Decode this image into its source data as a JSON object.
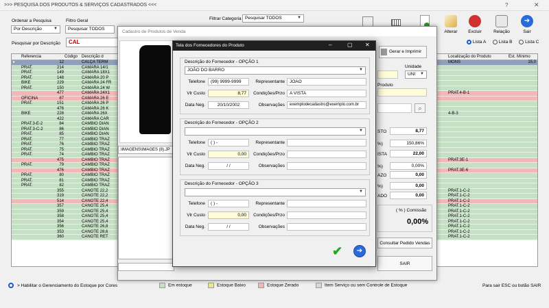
{
  "window": {
    "title": ">>> PESQUISA DOS PRODUTOS & SERVIÇOS CADASTRADOS <<<",
    "help": "?",
    "close": "✕"
  },
  "filters": {
    "ordenar_label": "Ordenar a Pesquisa",
    "ordenar_value": "Por Descrição",
    "filtro_label": "Filtro Geral",
    "filtro_value": "Pesquisar TODOS",
    "categoria_label": "Filtrar Categoria",
    "categoria_value": "Pesquisar TODOS",
    "pesquisar_label": "Pesquisar por Descrição",
    "pesquisar_value": "CAL"
  },
  "toolbar": {
    "alterar": "Alterar",
    "excluir": "Excluir",
    "relacao": "Relação",
    "sair": "Sair"
  },
  "lists": {
    "a": "Lista A",
    "b": "Lista B",
    "c": "Lista C"
  },
  "grid": {
    "headers": {
      "referencia": "Referencia",
      "codigo": "Código",
      "descricao": "Descrição d",
      "localizacao": "Localização do Produto",
      "est_minimo": "Est. Mínimo"
    },
    "rows": [
      {
        "ref": "",
        "cod": "12",
        "desc": "CALÇA TERM",
        "loc": "MONS",
        "min": "15,0",
        "c": "s"
      },
      {
        "ref": "PRAT.",
        "cod": "214",
        "desc": "CAMARA 14/1",
        "loc": "",
        "min": "",
        "c": "g"
      },
      {
        "ref": "PRAT.",
        "cod": "149",
        "desc": "CAMARA 18X1",
        "loc": "",
        "min": "",
        "c": "g"
      },
      {
        "ref": "PRAT.",
        "cod": "148",
        "desc": "CAMARA 20 P",
        "loc": "",
        "min": "",
        "c": "g"
      },
      {
        "ref": "BIKE",
        "cod": "229",
        "desc": "CAMARA 24 FR",
        "loc": "",
        "min": "",
        "c": "g"
      },
      {
        "ref": "PRAT.",
        "cod": "150",
        "desc": "CAMARA 24 W",
        "loc": "",
        "min": "",
        "c": "g"
      },
      {
        "ref": "",
        "cod": "477",
        "desc": "CAMARA 24X1",
        "loc": "PRAT.4-B-1",
        "min": "",
        "c": "p"
      },
      {
        "ref": "OFICINA",
        "cod": "87",
        "desc": "CAMARA 26 E",
        "loc": "",
        "min": "",
        "c": "p"
      },
      {
        "ref": "PRAT.",
        "cod": "151",
        "desc": "CAMARA 26 P",
        "loc": "",
        "min": "",
        "c": "g"
      },
      {
        "ref": "",
        "cod": "476",
        "desc": "CAMARA 26 K",
        "loc": "",
        "min": "",
        "c": "g"
      },
      {
        "ref": "BIKE",
        "cod": "228",
        "desc": "CAMARA 26X",
        "loc": "4-B-3",
        "min": "",
        "c": "g"
      },
      {
        "ref": "",
        "cod": "422",
        "desc": "CAMARA CAR",
        "loc": "",
        "min": "",
        "c": "g"
      },
      {
        "ref": "PRAT.3-E-2",
        "cod": "84",
        "desc": "CAMBIO DIAN",
        "loc": "",
        "min": "",
        "c": "g"
      },
      {
        "ref": "PRAT.3-C-2",
        "cod": "86",
        "desc": "CAMBIO DIAN",
        "loc": "",
        "min": "",
        "c": "g"
      },
      {
        "ref": "PRAT.",
        "cod": "85",
        "desc": "CAMBIO DIAN",
        "loc": "",
        "min": "",
        "c": "g"
      },
      {
        "ref": "PRAT.",
        "cod": "77",
        "desc": "CAMBIO TRAZ",
        "loc": "",
        "min": "",
        "c": "g"
      },
      {
        "ref": "PRAT.",
        "cod": "76",
        "desc": "CAMBIO TRAZ",
        "loc": "",
        "min": "",
        "c": "g"
      },
      {
        "ref": "PRAT.",
        "cod": "75",
        "desc": "CAMBIO TRAZ",
        "loc": "",
        "min": "",
        "c": "g"
      },
      {
        "ref": "PRAT.",
        "cod": "74",
        "desc": "CAMBIO TRAZ",
        "loc": "",
        "min": "",
        "c": "g"
      },
      {
        "ref": "",
        "cod": "475",
        "desc": "CAMBIO TRAZ",
        "loc": "PRAT.3E-1",
        "min": "",
        "c": "p"
      },
      {
        "ref": "PRAT.",
        "cod": "79",
        "desc": "CAMBIO TRAZ",
        "loc": "",
        "min": "",
        "c": "g"
      },
      {
        "ref": "",
        "cod": "476",
        "desc": "CAMBIO TRAZ",
        "loc": "PRAT.3E-6",
        "min": "",
        "c": "p"
      },
      {
        "ref": "PRAT.",
        "cod": "80",
        "desc": "CAMBIO TRAZ",
        "loc": "",
        "min": "",
        "c": "g"
      },
      {
        "ref": "PRAT.",
        "cod": "81",
        "desc": "CAMBIO TRAZ",
        "loc": "",
        "min": "",
        "c": "g"
      },
      {
        "ref": "PRAT.",
        "cod": "82",
        "desc": "CAMBIO TRAZ",
        "loc": "",
        "min": "",
        "c": "g"
      },
      {
        "ref": "",
        "cod": "355",
        "desc": "CANOTE 22,2",
        "loc": "PRAT.1-C-2",
        "min": "",
        "c": "g"
      },
      {
        "ref": "",
        "cod": "319",
        "desc": "CANOTE 22,2",
        "loc": "PRAT.1-C-2",
        "min": "",
        "c": "g"
      },
      {
        "ref": "",
        "cod": "514",
        "desc": "CANOTE 22,4",
        "loc": "PRAT.1-C-2",
        "min": "",
        "c": "p"
      },
      {
        "ref": "",
        "cod": "357",
        "desc": "CANOTE 25,4",
        "loc": "PRAT.1-C-2",
        "min": "",
        "c": "g"
      },
      {
        "ref": "",
        "cod": "359",
        "desc": "CANOTE 25,4",
        "loc": "PRAT.1-C-2",
        "min": "",
        "c": "g"
      },
      {
        "ref": "",
        "cod": "358",
        "desc": "CANOTE 25,4",
        "loc": "PRAT.1-C-2",
        "min": "",
        "c": "g"
      },
      {
        "ref": "",
        "cod": "354",
        "desc": "CANOTE 25,4",
        "loc": "PRAT.1-C-2",
        "min": "",
        "c": "g"
      },
      {
        "ref": "",
        "cod": "356",
        "desc": "CANOTE 26,8",
        "loc": "PRAT.1-C-2",
        "min": "",
        "c": "g"
      },
      {
        "ref": "",
        "cod": "353",
        "desc": "CANOTE 28,6",
        "loc": "PRAT.1-C-2",
        "min": "",
        "c": "g"
      },
      {
        "ref": "",
        "cod": "360",
        "desc": "CANOTE RET",
        "loc": "PRAT.1-C-2",
        "min": "",
        "c": "g"
      }
    ]
  },
  "bg_dialog": {
    "title": "Cadastro de Produtos de Venda",
    "image_path": ".\\IMAGENS\\IMAGES (8).JP",
    "gerar_imprimir": "Gerar e Imprimir",
    "unidade_label": "Unidade",
    "unidade_value": "UNI",
    "produto_label": "Produto",
    "custo_label": "STO",
    "custo_value": "8,77",
    "pct_label": "%)",
    "pct_value": "150,86%",
    "vista_label": "ISTA",
    "vista_value": "22,00",
    "pct2_label": "%)",
    "pct2_value": "0,00%",
    "prazo_label": "AZO",
    "prazo_value": "0,00",
    "row3_label": "%)",
    "row3_value": "0,00",
    "ado_label": "ADO",
    "ado_value": "0,00",
    "comissao_label": "( % ) Comissão",
    "comissao_value": "0,00%",
    "consultar": "Consultar Pedido Vendas",
    "sair": "SAIR"
  },
  "dialog": {
    "title": "Tela dos Fornecedores do Produto",
    "opcoes": [
      {
        "title": "Descrição do Fornecedor - OPÇÃO 1",
        "fornecedor": "JOÃO DO BARRO",
        "telefone": "(99) 9999-9999",
        "representante": "JOAO",
        "custo": "8,77",
        "condicoes": "A VISTA",
        "data": "20/10/2002",
        "observacoes": "exemplodecadastro@exemplo.com.br"
      },
      {
        "title": "Descrição do Fornecedor - OPÇÃO 2",
        "fornecedor": "",
        "telefone": "(  )    -",
        "representante": "",
        "custo": "0,00",
        "condicoes": "",
        "data": "/  /",
        "observacoes": ""
      },
      {
        "title": "Descrição do Fornecedor - OPÇÃO 3",
        "fornecedor": "",
        "telefone": "(  )    -",
        "representante": "",
        "custo": "0,00",
        "condicoes": "",
        "data": "/  /",
        "observacoes": ""
      }
    ],
    "labels": {
      "telefone": "Telefone",
      "representante": "Representante",
      "custo": "Vlr Custo",
      "condicoes": "Condições/Przo",
      "data": "Data Neg.",
      "observacoes": "Observações"
    }
  },
  "statusbar": {
    "habilitar": "> Habilitar o Gerenciamento do Estoque por Cores",
    "em_estoque": "Em estoque",
    "estoque_baixo": "Estoque Baixo",
    "estoque_zerado": "Estoque Zerado",
    "item_servico": "Item Serviço ou sem Controle de Estoque",
    "sair_hint": "Para sair ESC ou botão SAIR"
  },
  "colors": {
    "em_estoque": "#c6e0c6",
    "estoque_baixo": "#e8e890",
    "estoque_zerado": "#f2b8b8",
    "item_servico": "#d8d8d8"
  }
}
